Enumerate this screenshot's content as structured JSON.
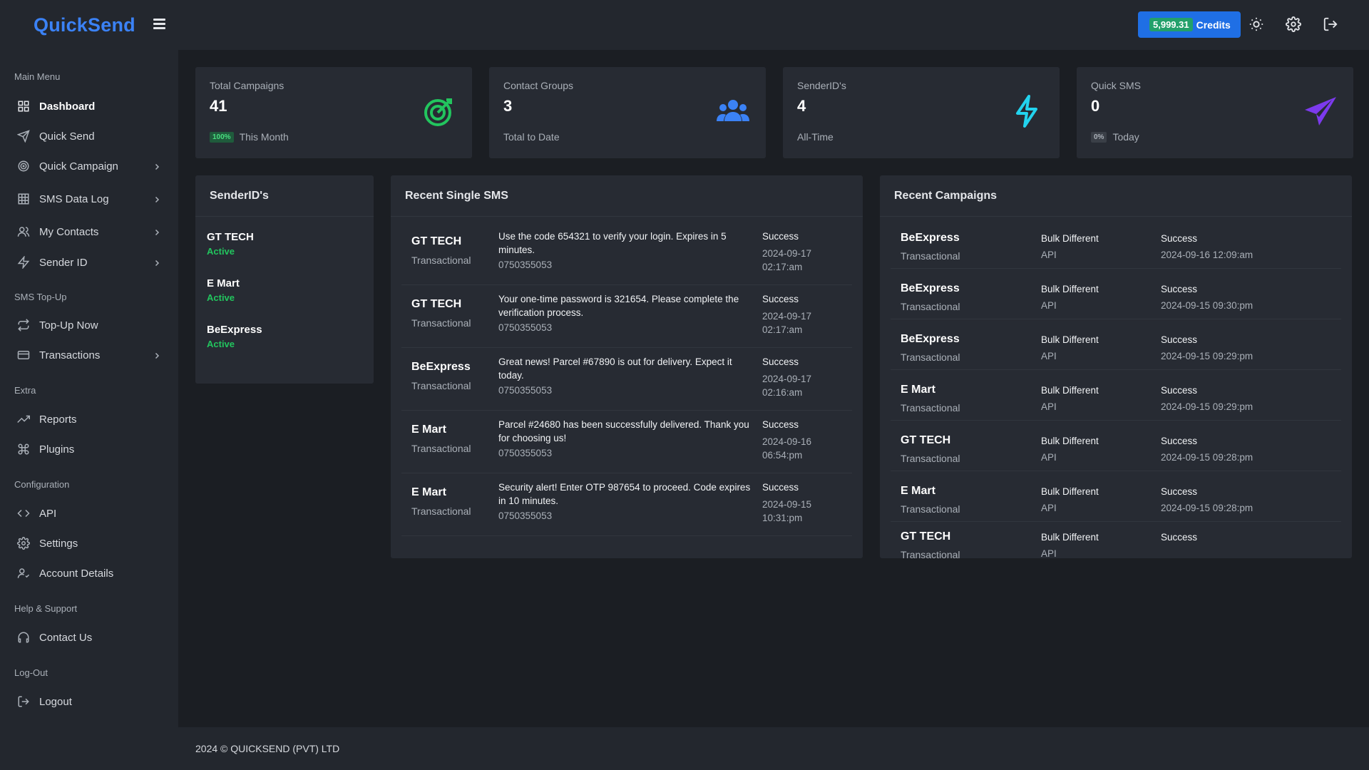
{
  "brand": {
    "name": "QuickSend"
  },
  "sidebar": {
    "sections": [
      "Main Menu",
      "SMS Top-Up",
      "Extra",
      "Configuration",
      "Help & Support",
      "Log-Out"
    ],
    "items": [
      {
        "label": "Dashboard",
        "icon": "grid-icon"
      },
      {
        "label": "Quick Send",
        "icon": "send-icon"
      },
      {
        "label": "Quick Campaign",
        "icon": "target-icon"
      },
      {
        "label": "SMS Data Log",
        "icon": "table-icon"
      },
      {
        "label": "My Contacts",
        "icon": "users-icon"
      },
      {
        "label": "Sender ID",
        "icon": "bolt-icon"
      },
      {
        "label": "Top-Up Now",
        "icon": "repeat-icon"
      },
      {
        "label": "Transactions",
        "icon": "card-icon"
      },
      {
        "label": "Reports",
        "icon": "trend-icon"
      },
      {
        "label": "Plugins",
        "icon": "command-icon"
      },
      {
        "label": "API",
        "icon": "code-icon"
      },
      {
        "label": "Settings",
        "icon": "gear-icon"
      },
      {
        "label": "Account Details",
        "icon": "user-check-icon"
      },
      {
        "label": "Contact Us",
        "icon": "headset-icon"
      },
      {
        "label": "Logout",
        "icon": "logout-icon"
      }
    ]
  },
  "topbar": {
    "credits_amount": "5,999.31",
    "credits_label": "Credits"
  },
  "stats": [
    {
      "title": "Total Campaigns",
      "value": "41",
      "badge": "100%",
      "sub": "This Month",
      "icon": "target-icon",
      "color": "#22c55e"
    },
    {
      "title": "Contact Groups",
      "value": "3",
      "badge": "",
      "sub": "Total to Date",
      "icon": "users-icon",
      "color": "#3b82f6"
    },
    {
      "title": "SenderID's",
      "value": "4",
      "badge": "",
      "sub": "All-Time",
      "icon": "bolt-icon",
      "color": "#22d3ee"
    },
    {
      "title": "Quick SMS",
      "value": "0",
      "badge": "0%",
      "sub": "Today",
      "icon": "send-icon",
      "color": "#7c3aed"
    }
  ],
  "senderids": {
    "title": "SenderID's",
    "items": [
      {
        "name": "GT TECH",
        "status": "Active"
      },
      {
        "name": "E Mart",
        "status": "Active"
      },
      {
        "name": "BeExpress",
        "status": "Active"
      }
    ]
  },
  "recent_sms": {
    "title": "Recent Single SMS",
    "rows": [
      {
        "sender": "GT TECH",
        "type": "Transactional",
        "message": "Use the code 654321 to verify your login. Expires in 5 minutes.",
        "phone": "0750355053",
        "status": "Success",
        "date": "2024-09-17",
        "time": "02:17:am"
      },
      {
        "sender": "GT TECH",
        "type": "Transactional",
        "message": "Your one-time password is 321654. Please complete the verification process.",
        "phone": "0750355053",
        "status": "Success",
        "date": "2024-09-17",
        "time": "02:17:am"
      },
      {
        "sender": "BeExpress",
        "type": "Transactional",
        "message": "Great news! Parcel #67890 is out for delivery. Expect it today.",
        "phone": "0750355053",
        "status": "Success",
        "date": "2024-09-17",
        "time": "02:16:am"
      },
      {
        "sender": "E Mart",
        "type": "Transactional",
        "message": "Parcel #24680 has been successfully delivered. Thank you for choosing us!",
        "phone": "0750355053",
        "status": "Success",
        "date": "2024-09-16",
        "time": "06:54:pm"
      },
      {
        "sender": "E Mart",
        "type": "Transactional",
        "message": "Security alert! Enter OTP 987654 to proceed. Code expires in 10 minutes.",
        "phone": "0750355053",
        "status": "Success",
        "date": "2024-09-15",
        "time": "10:31:pm"
      }
    ]
  },
  "recent_campaigns": {
    "title": "Recent Campaigns",
    "rows": [
      {
        "sender": "BeExpress",
        "type": "Transactional",
        "mode": "Bulk Different",
        "channel": "API",
        "status": "Success",
        "datetime": "2024-09-16 12:09:am"
      },
      {
        "sender": "BeExpress",
        "type": "Transactional",
        "mode": "Bulk Different",
        "channel": "API",
        "status": "Success",
        "datetime": "2024-09-15 09:30:pm"
      },
      {
        "sender": "BeExpress",
        "type": "Transactional",
        "mode": "Bulk Different",
        "channel": "API",
        "status": "Success",
        "datetime": "2024-09-15 09:29:pm"
      },
      {
        "sender": "E Mart",
        "type": "Transactional",
        "mode": "Bulk Different",
        "channel": "API",
        "status": "Success",
        "datetime": "2024-09-15 09:29:pm"
      },
      {
        "sender": "GT TECH",
        "type": "Transactional",
        "mode": "Bulk Different",
        "channel": "API",
        "status": "Success",
        "datetime": "2024-09-15 09:28:pm"
      },
      {
        "sender": "E Mart",
        "type": "Transactional",
        "mode": "Bulk Different",
        "channel": "API",
        "status": "Success",
        "datetime": "2024-09-15 09:28:pm"
      },
      {
        "sender": "GT TECH",
        "type": "Transactional",
        "mode": "Bulk Different",
        "channel": "API",
        "status": "Success",
        "datetime": ""
      }
    ]
  },
  "footer": {
    "text": "2024 © QUICKSEND (PVT) LTD"
  }
}
